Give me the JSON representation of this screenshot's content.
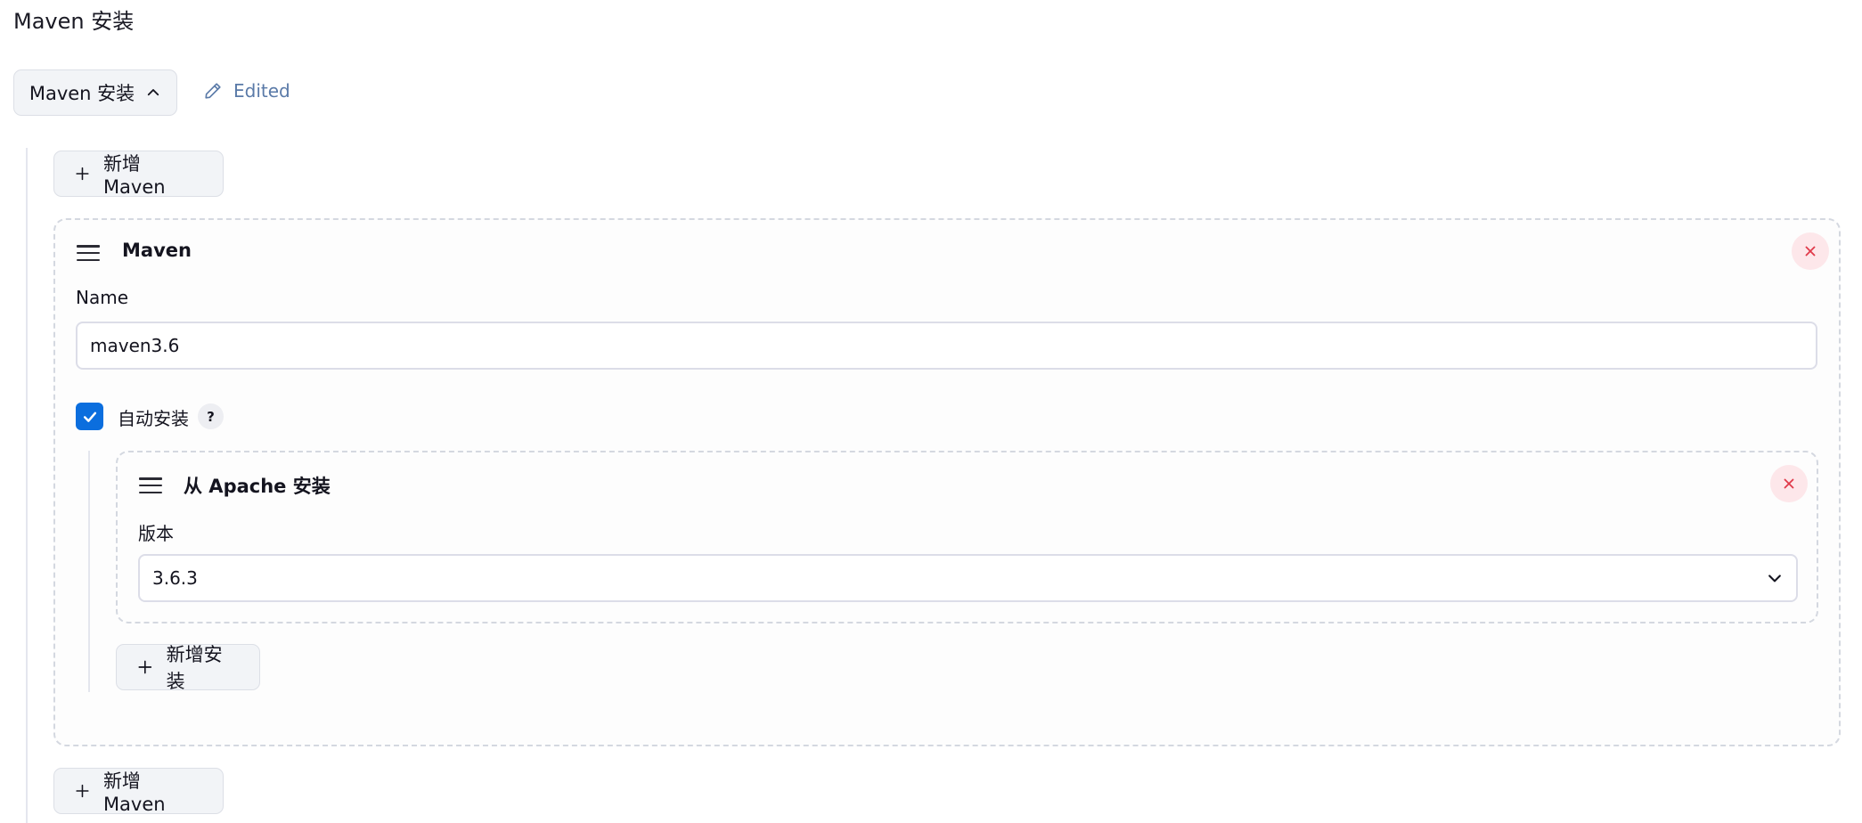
{
  "section": {
    "title": "Maven 安装"
  },
  "toggle": {
    "label": "Maven 安装",
    "icon": "chevron-up-icon"
  },
  "edited": {
    "label": "Edited",
    "icon": "pencil-icon",
    "color": "#5a7aa8"
  },
  "buttons": {
    "add_maven_top": "新增 Maven",
    "add_maven_bottom": "新增 Maven",
    "add_install": "新增安装"
  },
  "maven_card": {
    "title": "Maven",
    "name_label": "Name",
    "name_value": "maven3.6",
    "auto_install": {
      "label": "自动安装",
      "checked": true,
      "help": "?"
    }
  },
  "apache_card": {
    "title": "从 Apache 安装",
    "version_label": "版本",
    "version_value": "3.6.3"
  },
  "colors": {
    "accent": "#0b6ede",
    "close_bg": "#fde7ea",
    "close_icon": "#e03a4a",
    "button_bg": "#f2f4f7"
  }
}
